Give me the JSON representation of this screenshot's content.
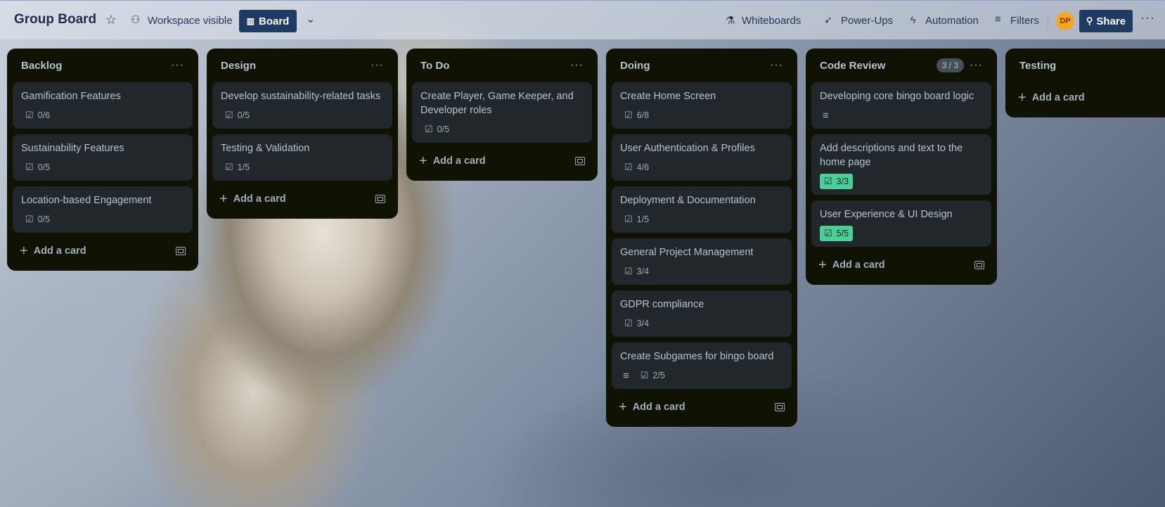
{
  "header": {
    "board_title": "Group Board",
    "visibility": "Workspace visible",
    "view_button": "Board",
    "whiteboards": "Whiteboards",
    "powerups": "Power-Ups",
    "automation": "Automation",
    "filters": "Filters",
    "avatar_initials": "DP",
    "share": "Share"
  },
  "lists": [
    {
      "title": "Backlog",
      "add_label": "Add a card",
      "cards": [
        {
          "title": "Gamification Features",
          "checklist": "0/6"
        },
        {
          "title": "Sustainability Features",
          "checklist": "0/5"
        },
        {
          "title": "Location-based Engagement",
          "checklist": "0/5"
        }
      ]
    },
    {
      "title": "Design",
      "add_label": "Add a card",
      "cards": [
        {
          "title": "Develop sustainability-related tasks",
          "checklist": "0/5"
        },
        {
          "title": "Testing & Validation",
          "checklist": "1/5"
        }
      ]
    },
    {
      "title": "To Do",
      "add_label": "Add a card",
      "cards": [
        {
          "title": "Create Player, Game Keeper, and Developer roles",
          "checklist": "0/5"
        }
      ]
    },
    {
      "title": "Doing",
      "add_label": "Add a card",
      "cards": [
        {
          "title": "Create Home Screen",
          "checklist": "6/8"
        },
        {
          "title": "User Authentication & Profiles",
          "checklist": "4/6"
        },
        {
          "title": "Deployment & Documentation",
          "checklist": "1/5"
        },
        {
          "title": "General Project Management",
          "checklist": "3/4"
        },
        {
          "title": "GDPR compliance",
          "checklist": "3/4"
        },
        {
          "title": "Create Subgames for bingo board",
          "checklist": "2/5",
          "has_description": true
        }
      ]
    },
    {
      "title": "Code Review",
      "count_badge": "3 / 3",
      "add_label": "Add a card",
      "cards": [
        {
          "title": "Developing core bingo board logic",
          "has_description": true
        },
        {
          "title": "Add descriptions and text to the home page",
          "checklist": "3/3",
          "complete": true
        },
        {
          "title": "User Experience & UI Design",
          "checklist": "5/5",
          "complete": true
        }
      ]
    },
    {
      "title": "Testing",
      "add_label": "Add a card",
      "cards": []
    }
  ],
  "colors": {
    "list_bg": "#101204",
    "card_bg": "#22272b",
    "complete_badge": "#4bce97",
    "nav_button": "#1f3a63",
    "avatar": "#f5a623"
  }
}
